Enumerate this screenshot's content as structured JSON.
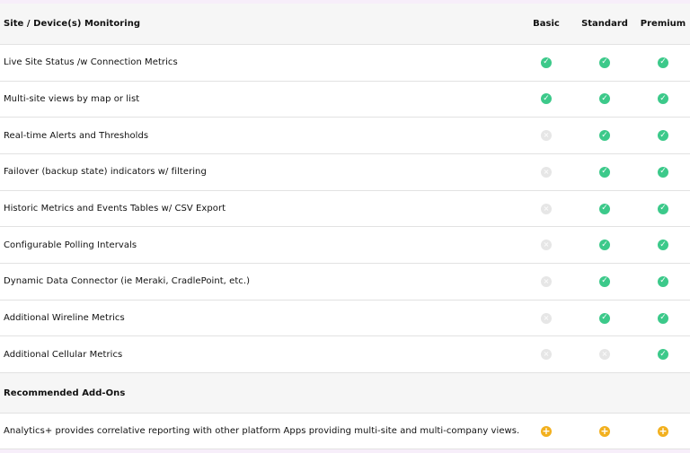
{
  "header": {
    "title": "Site / Device(s) Monitoring",
    "columns": [
      "Basic",
      "Standard",
      "Premium"
    ]
  },
  "features": [
    {
      "label": "Live Site Status /w Connection Metrics",
      "basic": "check",
      "standard": "check",
      "premium": "check"
    },
    {
      "label": "Multi-site views by map or list",
      "basic": "check",
      "standard": "check",
      "premium": "check"
    },
    {
      "label": "Real-time Alerts and Thresholds",
      "basic": "x",
      "standard": "check",
      "premium": "check"
    },
    {
      "label": "Failover (backup state) indicators w/ filtering",
      "basic": "x",
      "standard": "check",
      "premium": "check"
    },
    {
      "label": "Historic Metrics and Events Tables w/ CSV Export",
      "basic": "x",
      "standard": "check",
      "premium": "check"
    },
    {
      "label": "Configurable Polling Intervals",
      "basic": "x",
      "standard": "check",
      "premium": "check"
    },
    {
      "label": "Dynamic Data Connector (ie Meraki, CradlePoint, etc.)",
      "basic": "x",
      "standard": "check",
      "premium": "check"
    },
    {
      "label": "Additional Wireline Metrics",
      "basic": "x",
      "standard": "check",
      "premium": "check"
    },
    {
      "label": "Additional Cellular Metrics",
      "basic": "x",
      "standard": "x",
      "premium": "check"
    }
  ],
  "addons": {
    "title": "Recommended Add-Ons",
    "items": [
      {
        "label": "Analytics+ provides correlative reporting with other platform Apps providing multi-site and multi-company views.",
        "basic": "plus",
        "standard": "plus",
        "premium": "plus"
      }
    ]
  },
  "colors": {
    "check": "#3cc98a",
    "x": "#e6e6e6",
    "plus": "#f2b01e"
  },
  "icons": {
    "check": "check-circle-icon",
    "x": "x-circle-icon",
    "plus": "plus-circle-icon"
  }
}
